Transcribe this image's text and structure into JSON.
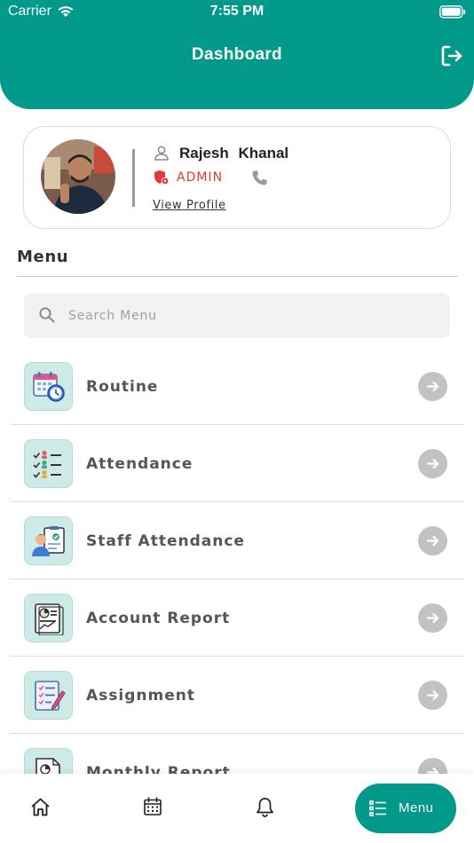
{
  "status_bar": {
    "carrier": "Carrier",
    "time": "7:55 PM"
  },
  "header": {
    "title": "Dashboard",
    "logout_icon": "logout-icon"
  },
  "profile": {
    "first_name": "Rajesh",
    "last_name": "Khanal",
    "full_name": "Rajesh  Khanal",
    "role": "ADMIN",
    "view_profile": "View Profile"
  },
  "menu": {
    "heading": "Menu",
    "search_placeholder": "Search Menu",
    "items": [
      {
        "label": "Routine",
        "icon": "calendar-clock-icon"
      },
      {
        "label": "Attendance",
        "icon": "checklist-people-icon"
      },
      {
        "label": "Staff Attendance",
        "icon": "staff-badge-icon"
      },
      {
        "label": "Account Report",
        "icon": "report-chart-icon"
      },
      {
        "label": "Assignment",
        "icon": "assignment-pen-icon"
      },
      {
        "label": "Monthly Report",
        "icon": "monthly-report-icon"
      }
    ]
  },
  "tab_bar": {
    "home_icon": "home-icon",
    "calendar_icon": "calendar-icon",
    "bell_icon": "bell-icon",
    "menu_label": "Menu"
  },
  "colors": {
    "primary": "#00998a",
    "role": "#e53935",
    "icon_tile": "#cdeae6",
    "arrow": "#c2c2c2"
  }
}
